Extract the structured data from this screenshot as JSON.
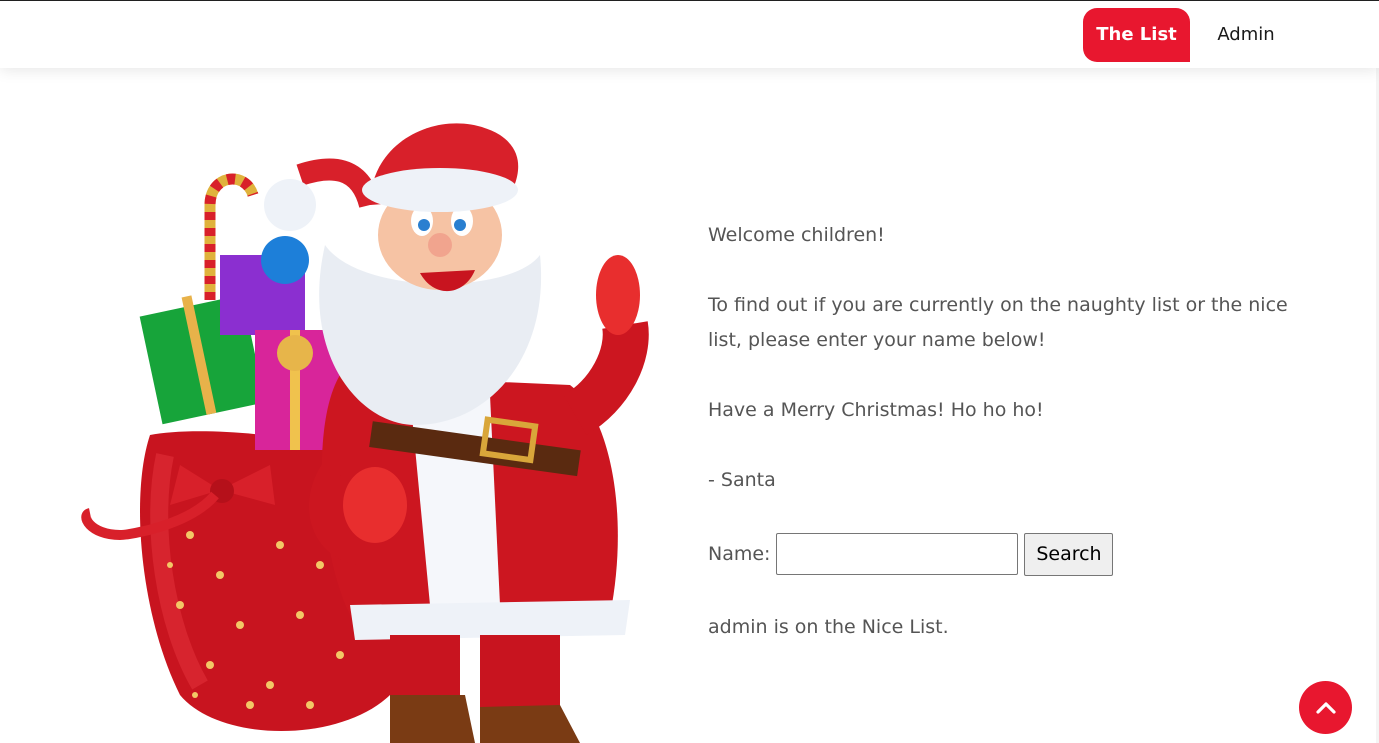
{
  "nav": {
    "items": [
      {
        "label": "The List",
        "active": true
      },
      {
        "label": "Admin",
        "active": false
      }
    ]
  },
  "colors": {
    "accent": "#e8172f",
    "text": "#555555"
  },
  "main": {
    "illustration": "santa-claus-with-gift-sack",
    "paragraphs": [
      "Welcome children!",
      "To find out if you are currently on the naughty list or the nice list, please enter your name below!",
      "Have a Merry Christmas! Ho ho ho!",
      "- Santa"
    ],
    "form": {
      "label": "Name:",
      "value": "",
      "placeholder": "",
      "button_label": "Search"
    },
    "result": "admin is on the Nice List."
  },
  "back_to_top": {
    "icon": "chevron-up-icon"
  }
}
